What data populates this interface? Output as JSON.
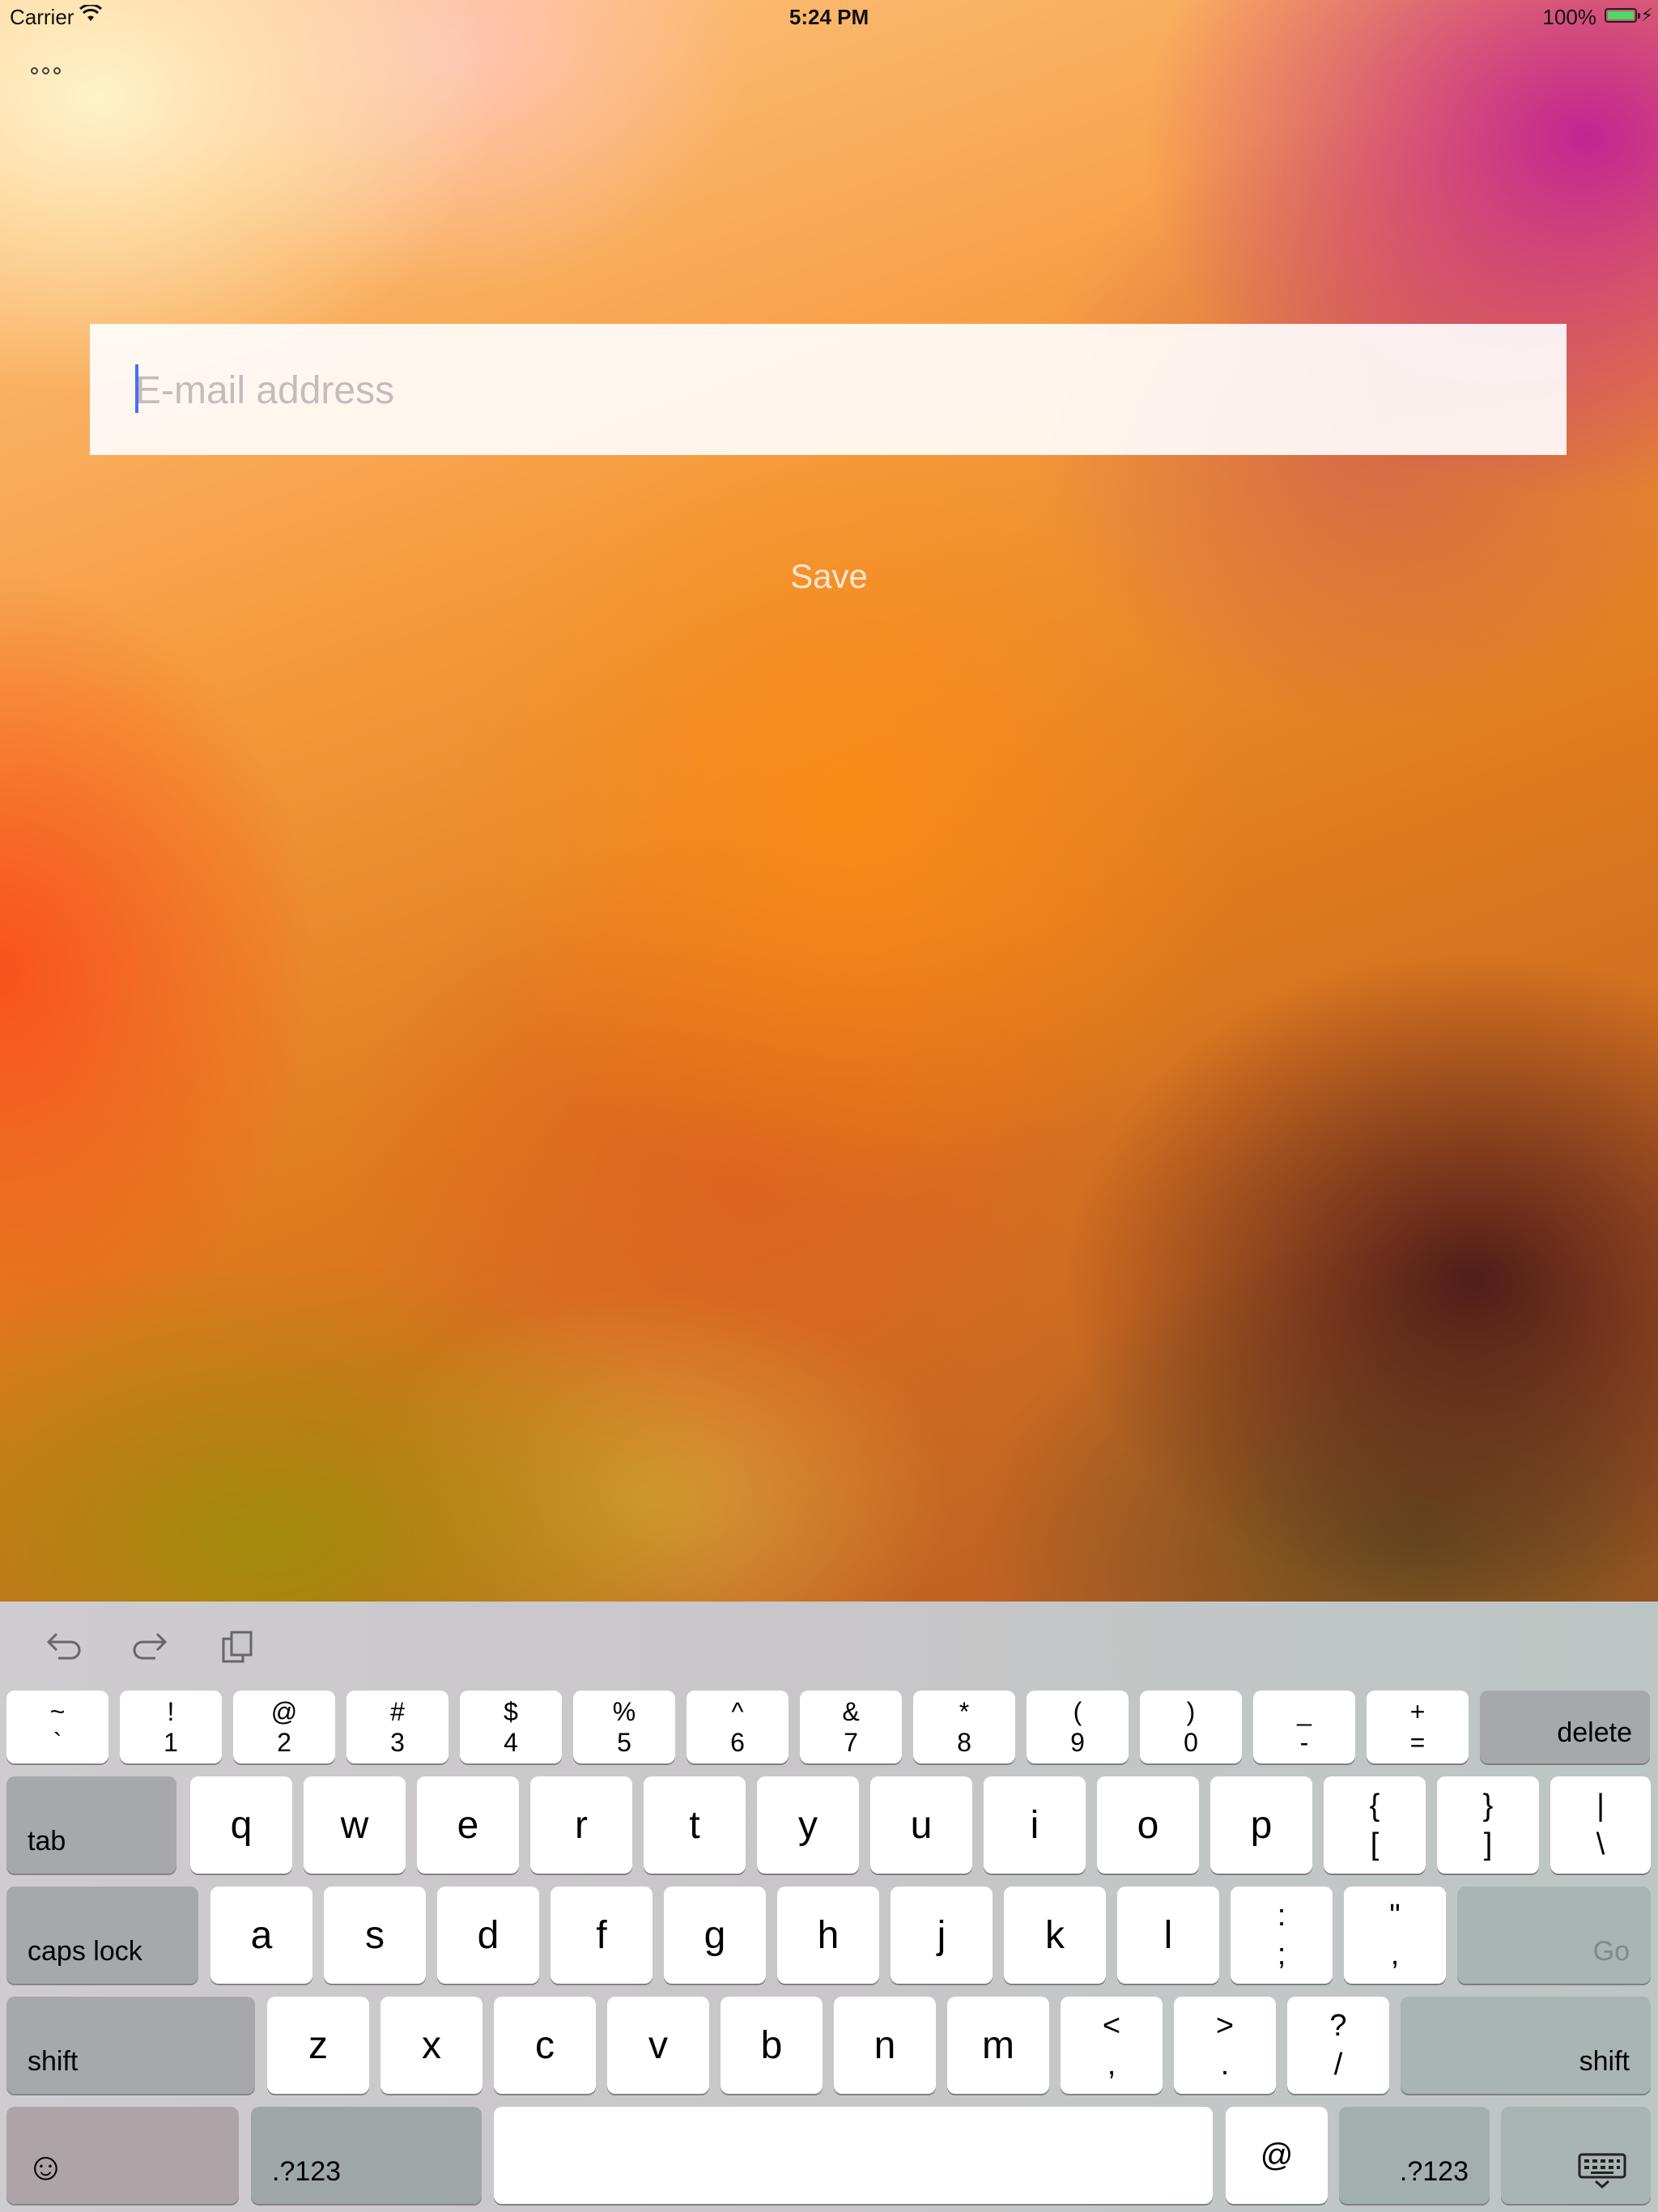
{
  "status_bar": {
    "carrier": "Carrier",
    "time": "5:24 PM",
    "battery": "100%",
    "battery_level": 1.0
  },
  "more_button": {
    "icon": "ellipsis-icon"
  },
  "email": {
    "placeholder": "E-mail address",
    "value": ""
  },
  "save_label": "Save",
  "keyboard": {
    "toolbar": [
      "undo-icon",
      "redo-icon",
      "paste-icon"
    ],
    "number_row": [
      {
        "top": "~",
        "bottom": "`"
      },
      {
        "top": "!",
        "bottom": "1"
      },
      {
        "top": "@",
        "bottom": "2"
      },
      {
        "top": "#",
        "bottom": "3"
      },
      {
        "top": "$",
        "bottom": "4"
      },
      {
        "top": "%",
        "bottom": "5"
      },
      {
        "top": "^",
        "bottom": "6"
      },
      {
        "top": "&",
        "bottom": "7"
      },
      {
        "top": "*",
        "bottom": "8"
      },
      {
        "top": "(",
        "bottom": "9"
      },
      {
        "top": ")",
        "bottom": "0"
      },
      {
        "top": "_",
        "bottom": "-"
      },
      {
        "top": "+",
        "bottom": "="
      }
    ],
    "delete": "delete",
    "tab": "tab",
    "row_q": [
      "q",
      "w",
      "e",
      "r",
      "t",
      "y",
      "u",
      "i",
      "o",
      "p"
    ],
    "row_q_symbols": [
      {
        "top": "{",
        "bottom": "["
      },
      {
        "top": "}",
        "bottom": "]"
      },
      {
        "top": "|",
        "bottom": "\\"
      }
    ],
    "caps_lock": "caps lock",
    "row_a": [
      "a",
      "s",
      "d",
      "f",
      "g",
      "h",
      "j",
      "k",
      "l"
    ],
    "row_a_symbols": [
      {
        "top": ":",
        "bottom": ";"
      },
      {
        "top": "\"",
        "bottom": ","
      }
    ],
    "go": "Go",
    "shift": "shift",
    "row_z": [
      "z",
      "x",
      "c",
      "v",
      "b",
      "n",
      "m"
    ],
    "row_z_symbols": [
      {
        "top": "<",
        "bottom": ","
      },
      {
        "top": ">",
        "bottom": "."
      },
      {
        "top": "?",
        "bottom": "/"
      }
    ],
    "emoji": "☺",
    "numbers": ".?123",
    "at": "@",
    "dismiss_icon": "keyboard-dismiss-icon"
  }
}
